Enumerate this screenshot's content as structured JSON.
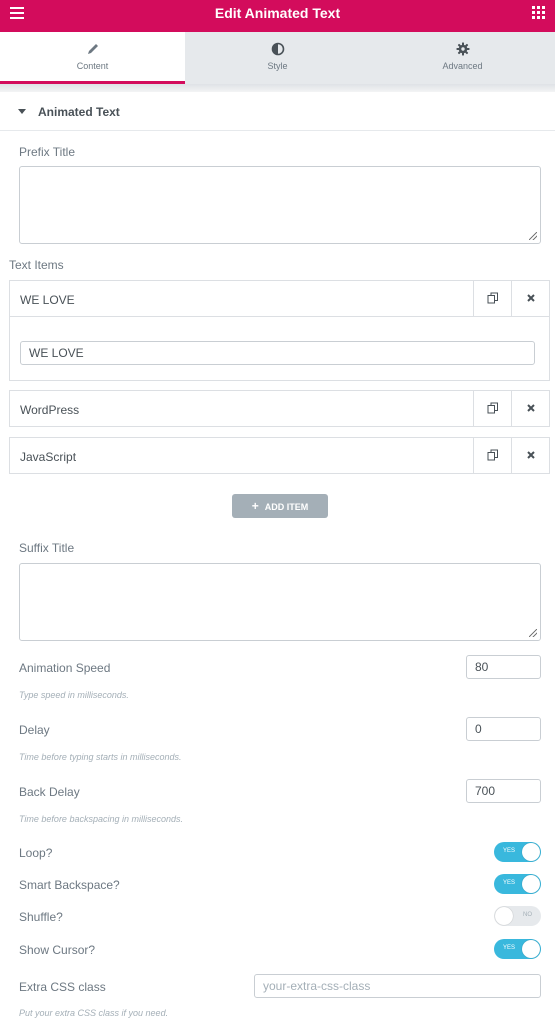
{
  "header": {
    "title": "Edit Animated Text",
    "menu_icon": "hamburger-icon",
    "apps_icon": "grid-icon"
  },
  "tabs": [
    {
      "label": "Content",
      "icon": "pencil-icon",
      "active": true
    },
    {
      "label": "Style",
      "icon": "half-circle-icon",
      "active": false
    },
    {
      "label": "Advanced",
      "icon": "gear-icon",
      "active": false
    }
  ],
  "section": {
    "title": "Animated Text"
  },
  "prefix": {
    "label": "Prefix Title",
    "value": ""
  },
  "text_items": {
    "label": "Text Items",
    "items": [
      {
        "title": "WE LOVE",
        "input_value": "WE LOVE",
        "expanded": true
      },
      {
        "title": "WordPress",
        "expanded": false
      },
      {
        "title": "JavaScript",
        "expanded": false
      }
    ],
    "add_label": "ADD ITEM"
  },
  "suffix": {
    "label": "Suffix Title",
    "value": ""
  },
  "animation_speed": {
    "label": "Animation Speed",
    "value": "80",
    "desc": "Type speed in milliseconds."
  },
  "delay": {
    "label": "Delay",
    "value": "0",
    "desc": "Time before typing starts in milliseconds."
  },
  "back_delay": {
    "label": "Back Delay",
    "value": "700",
    "desc": "Time before backspacing in milliseconds."
  },
  "loop": {
    "label": "Loop?",
    "state": "YES",
    "on": true
  },
  "smart_backspace": {
    "label": "Smart Backspace?",
    "state": "YES",
    "on": true
  },
  "shuffle": {
    "label": "Shuffle?",
    "state": "NO",
    "on": false
  },
  "show_cursor": {
    "label": "Show Cursor?",
    "state": "YES",
    "on": true
  },
  "extra_css": {
    "label": "Extra CSS class",
    "placeholder": "your-extra-css-class",
    "desc": "Put your extra CSS class if you need."
  },
  "colors": {
    "accent": "#d30c5c",
    "switch_on": "#39b8dd",
    "button_gray": "#a4afb7"
  }
}
